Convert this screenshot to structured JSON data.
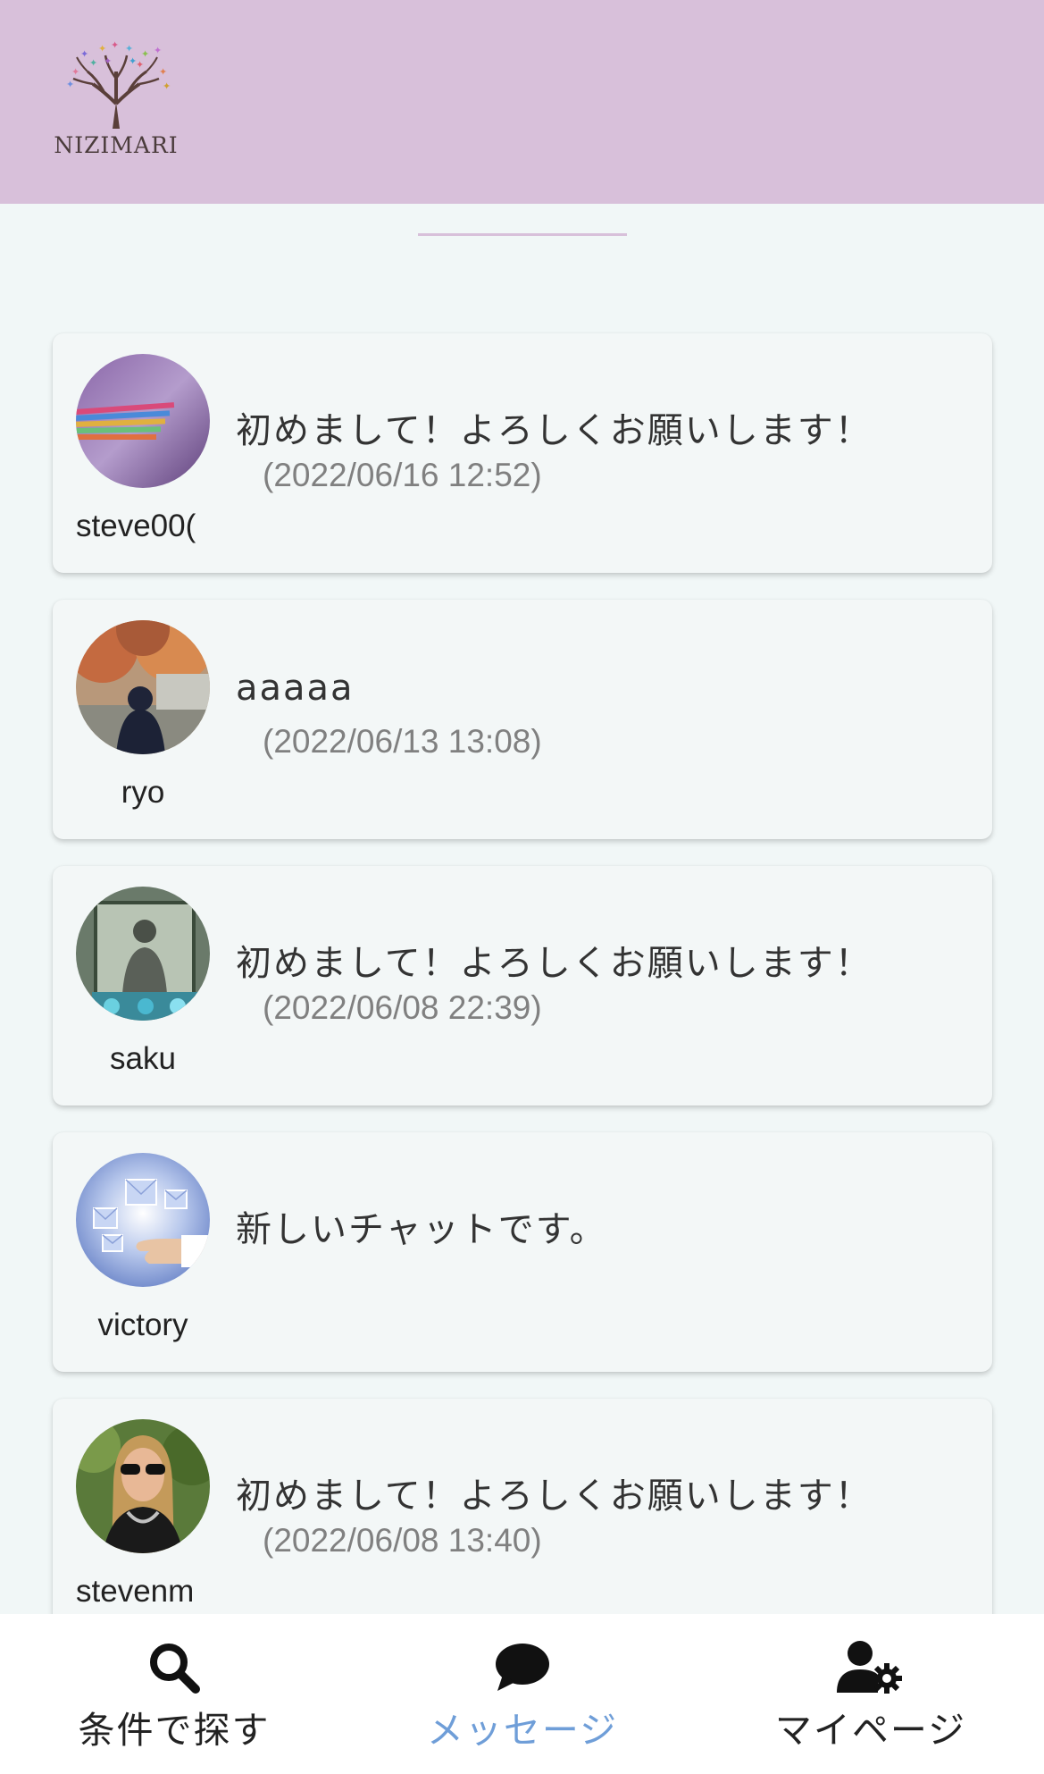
{
  "header": {
    "logo_text": "NIZIMARI",
    "background": "#d8c0da"
  },
  "chats": [
    {
      "username": "steve00(",
      "message": "初めまして！よろしくお願いします！",
      "timestamp": "(2022/06/16 12:52)",
      "avatar_icon": "purple-abstract-avatar"
    },
    {
      "username": "ryo",
      "message": "aaaaa",
      "timestamp": "(2022/06/13 13:08)",
      "avatar_icon": "autumn-person-avatar"
    },
    {
      "username": "saku",
      "message": "初めまして！よろしくお願いします！",
      "timestamp": "(2022/06/08 22:39)",
      "avatar_icon": "framed-portrait-avatar"
    },
    {
      "username": "victory",
      "message": "新しいチャットです。",
      "timestamp": "",
      "avatar_icon": "mail-hand-avatar"
    },
    {
      "username": "stevenm",
      "message": "初めまして！よろしくお願いします！",
      "timestamp": "(2022/06/08 13:40)",
      "avatar_icon": "woman-sunglasses-avatar"
    }
  ],
  "nav": {
    "items": [
      {
        "label": "条件で探す",
        "icon": "search-icon",
        "active": false
      },
      {
        "label": "メッセージ",
        "icon": "chat-bubble-icon",
        "active": true
      },
      {
        "label": "マイページ",
        "icon": "user-settings-icon",
        "active": false
      }
    ],
    "active_color": "#6f9ed8"
  }
}
